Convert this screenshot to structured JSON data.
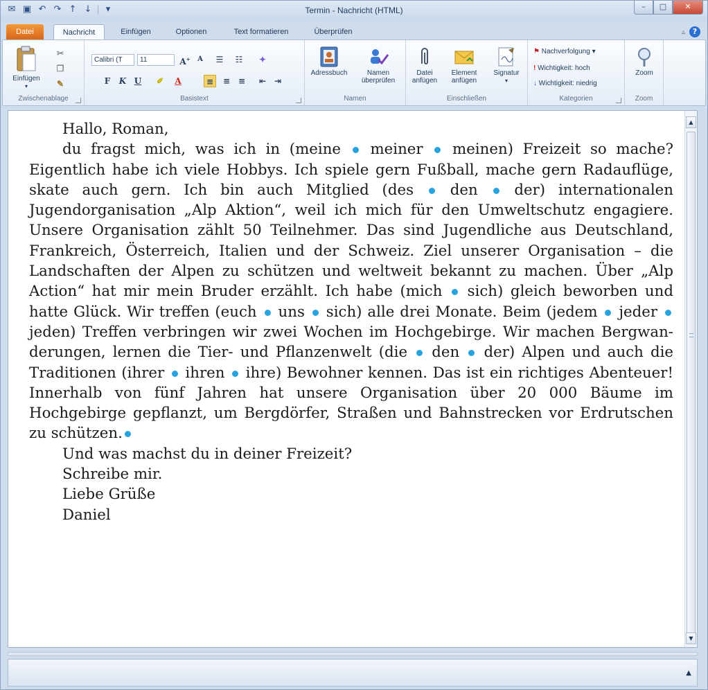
{
  "window": {
    "title": "Termin - Nachricht (HTML)",
    "controls": {
      "minimize": "–",
      "maximize": "□",
      "close": "✕"
    }
  },
  "qat": {
    "icons": [
      "outlook-icon",
      "save-icon",
      "undo-icon",
      "redo-icon",
      "up-icon",
      "down-icon",
      "customize-icon"
    ]
  },
  "tabs": [
    "Datei",
    "Nachricht",
    "Einfügen",
    "Optionen",
    "Text formatieren",
    "Überprüfen"
  ],
  "active_tab": "Nachricht",
  "ribbon": {
    "groups": {
      "clipboard": "Zwischenablage",
      "basictext": "Basistext",
      "names": "Namen",
      "include": "Einschließen",
      "categories": "Kategorien",
      "zoom": "Zoom"
    },
    "paste": "Einfügen",
    "font_name": "Calibri (T",
    "font_size": "11",
    "addressbook": "Adressbuch",
    "check_names": [
      "Namen",
      "überprüfen"
    ],
    "attach_file": [
      "Datei",
      "anfügen"
    ],
    "attach_item": [
      "Element",
      "anfügen"
    ],
    "signature": "Signatur",
    "followup": "Nachverfolgung",
    "high_importance": "Wichtigkeit: hoch",
    "low_importance": "Wichtigkeit: niedrig",
    "zoom": "Zoom",
    "tools": {
      "bold": "F",
      "italic": "K",
      "underline": "U"
    }
  },
  "letter": {
    "greeting": "Hallo, Roman,",
    "body": [
      "du fragst mich, was ich in (meine ",
      " meiner ",
      " meinen) Freizeit so mache? Eigentlich habe ich viele Hobbys. Ich spiele gern Fußball, mache gern Radauflüge, skate auch gern. Ich bin auch Mitglied (des ",
      " den ",
      " der) internationalen Jugendorganisation „Alp Aktion“, weil ich mich für den Umweltschutz engagiere. Unsere Organisation zählt 50 Teilnehmer. Das sind  Jugendliche aus Deutschland, Frank­reich, Österreich, Italien und der Schweiz. Ziel unserer Organisation – die Landschaften der Alpen zu schützen und weltweit bekannt zu machen. Über „Alp Action“ hat mir mein Bruder erzählt. Ich habe (mich ",
      " sich) gleich beworben und hatte Glück. Wir treffen (euch ",
      " uns ",
      " sich) alle drei Monate. Beim (jedem ",
      " jeder ",
      " jeden) Treffen verbringen wir zwei Wochen im Hochgebirge. Wir machen Bergwan­derungen,  lernen die Tier- und Pflanzenwelt (die ",
      " den ",
      " der) Alpen und auch die Traditionen (ihrer ",
      " ihren ",
      " ihre) Bewohner kennen. Das ist ein richtiges Abenteuer! Innerhalb von fünf Jahren hat un­sere Organisation über 20 000 Bäume im Hochgebirge gepflanzt, um Bergdörfer, Straßen und Bahnstrecken vor Erdrutschen zu schützen."
    ],
    "question": "Und was machst du in deiner Freizeit?",
    "closing1": "Schreibe mir.",
    "closing2": "Liebe Grüße",
    "signature": "Daniel"
  },
  "colors": {
    "bullet": "#29a2e0",
    "file_tab": "#e5792a",
    "close_button": "#c44a34"
  }
}
